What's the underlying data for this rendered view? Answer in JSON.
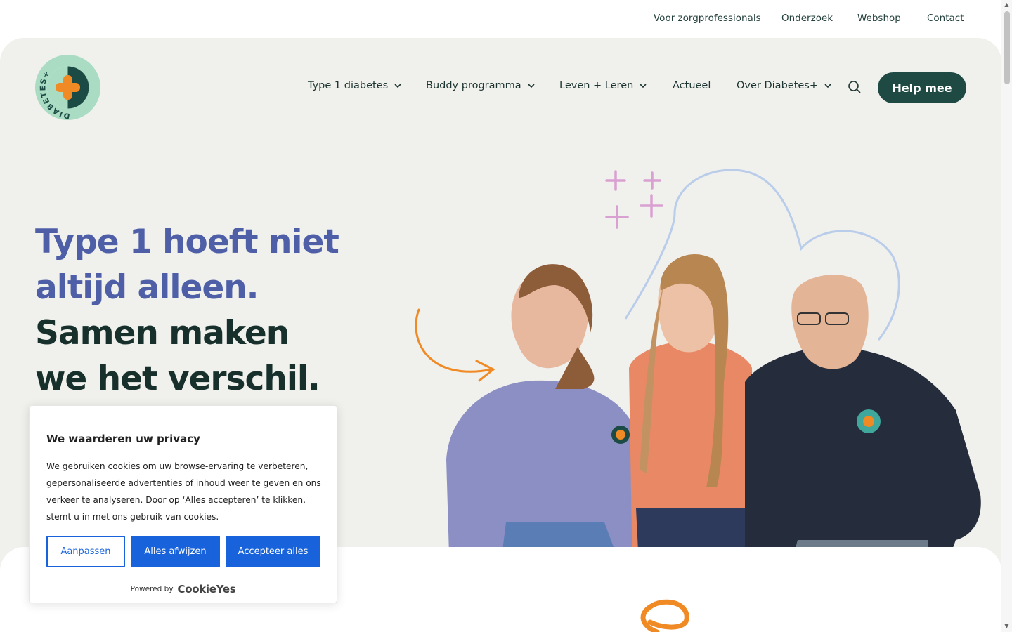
{
  "utility_nav": [
    "Voor zorgprofessionals",
    "Onderzoek",
    "Webshop",
    "Contact"
  ],
  "logo": {
    "text": "DIABETES+"
  },
  "main_nav": {
    "items": [
      {
        "label": "Type 1 diabetes"
      },
      {
        "label": "Buddy programma"
      },
      {
        "label": "Leven + Leren"
      },
      {
        "label": "Actueel"
      },
      {
        "label": "Over Diabetes+"
      }
    ],
    "help_button": "Help mee"
  },
  "hero": {
    "line1": "Type 1 hoeft niet",
    "line2": "altijd alleen.",
    "line3": "Samen maken",
    "line4": "we het verschil."
  },
  "cookie": {
    "title": "We waarderen uw privacy",
    "body": "We gebruiken cookies om uw browse-ervaring te verbeteren, gepersonaliseerde advertenties of inhoud weer te geven en ons verkeer te analyseren. Door op ‘Alles accepteren’ te klikken, stemt u in met ons gebruik van cookies.",
    "btn_customize": "Aanpassen",
    "btn_reject": "Alles afwijzen",
    "btn_accept": "Accepteer alles",
    "powered_by": "Powered by",
    "brand": "CookieYes"
  },
  "colors": {
    "brand_dark": "#1f4a43",
    "headline_blue": "#4e5fa8",
    "accent_orange": "#f08a24",
    "cookie_blue": "#1863dc",
    "hero_bg": "#f0f0ec"
  }
}
